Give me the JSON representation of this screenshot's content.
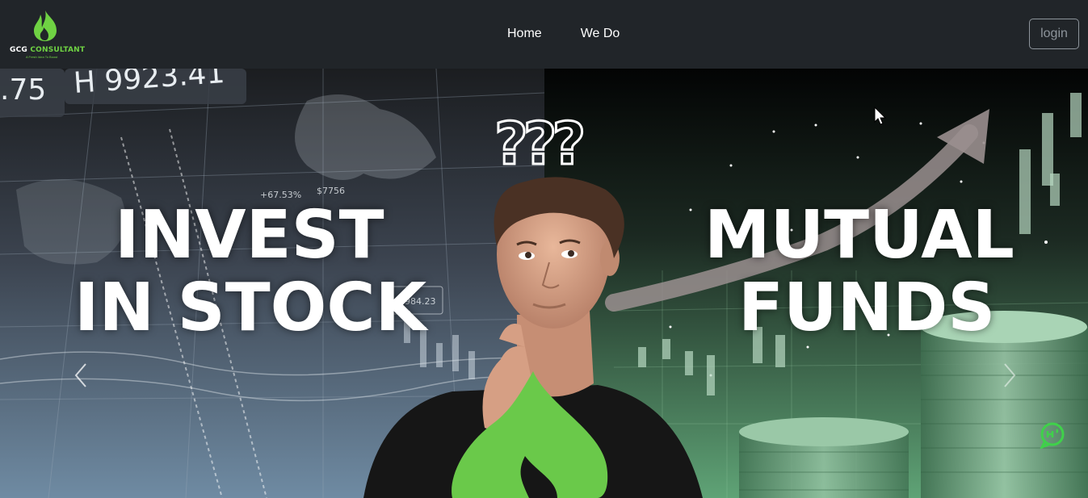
{
  "brand": {
    "name_part1": "GCG",
    "name_part2": "CONSULTANT",
    "tagline": "A Fresh Idea To Boost",
    "logo_icon": "flame-icon",
    "accent_color": "#6fd243"
  },
  "nav": {
    "links": [
      {
        "label": "Home"
      },
      {
        "label": "We Do"
      }
    ],
    "login_label": "login"
  },
  "hero": {
    "left_line1": "INVEST",
    "left_line2": "IN STOCK",
    "right_line1": "MUTUAL",
    "right_line2": "FUNDS",
    "question_marks": "???",
    "ticker_left": ".75",
    "ticker_main": "H 9923.41",
    "ticker_pct": "+67.53%",
    "ticker_val": "$7756",
    "ticker_small": "3984.23",
    "prev_icon": "chevron-left-icon",
    "next_icon": "chevron-right-icon"
  },
  "chat": {
    "icon": "chat-bubble-icon"
  }
}
